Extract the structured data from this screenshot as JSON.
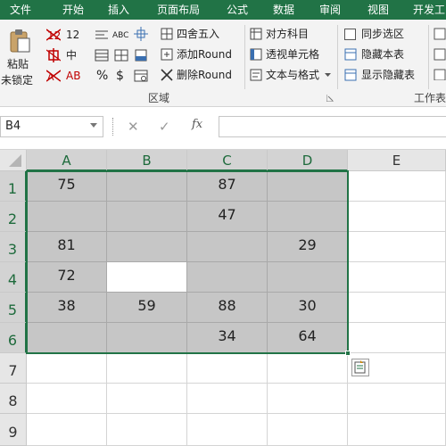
{
  "ribbon_tabs": [
    "文件",
    "开始",
    "插入",
    "页面布局",
    "公式",
    "数据",
    "审阅",
    "视图",
    "开发工"
  ],
  "ribbon": {
    "paste_label": "粘贴",
    "unlock_label": "未锁定",
    "btn_12": "12",
    "btn_zhong": "中",
    "btn_ab": "AB",
    "btn_percent": "%",
    "btn_dollar": "$",
    "btn_abc": "ABC",
    "round_label": "四舍五入",
    "add_round_label": "添加Round",
    "delete_round_label": "删除Round",
    "group_label_region": "区域",
    "subject_label": "对方科目",
    "pivot_label": "透视单元格",
    "text_format_label": "文本与格式",
    "sync_select_label": "同步选区",
    "hide_sheet_label": "隐藏本表",
    "show_hidden_label": "显示隐藏表",
    "group_label_worksheet": "工作表"
  },
  "formula_bar": {
    "name_box": "B4",
    "cancel_symbol": "✕",
    "confirm_symbol": "✓",
    "fx_label": "fx",
    "formula_value": ""
  },
  "grid": {
    "columns": [
      "A",
      "B",
      "C",
      "D",
      "E"
    ],
    "rows": [
      "1",
      "2",
      "3",
      "4",
      "5",
      "6",
      "7",
      "8",
      "9"
    ],
    "cells": [
      [
        "75",
        "",
        "87",
        "",
        ""
      ],
      [
        "",
        "",
        "47",
        "",
        ""
      ],
      [
        "81",
        "",
        "",
        "29",
        ""
      ],
      [
        "72",
        "",
        "",
        "",
        ""
      ],
      [
        "38",
        "59",
        "88",
        "30",
        ""
      ],
      [
        "",
        "",
        "34",
        "64",
        ""
      ],
      [
        "",
        "",
        "",
        "",
        ""
      ],
      [
        "",
        "",
        "",
        "",
        ""
      ],
      [
        "",
        "",
        "",
        "",
        ""
      ]
    ],
    "selection": "A1:D6",
    "active_cell": "B4"
  },
  "colors": {
    "accent": "#217346",
    "selection_fill": "#c6c6c6",
    "header_fill": "#e6e6e6"
  },
  "icons": [
    "paste-icon",
    "strikethrough-12-icon",
    "strikethrough-zhong-icon",
    "strikethrough-ab-icon",
    "percent-icon",
    "currency-icon",
    "abc-format-icon",
    "round-icon",
    "add-round-icon",
    "delete-round-icon",
    "subject-icon",
    "pivot-icon",
    "text-format-icon",
    "checkbox-icon",
    "quick-analysis-icon"
  ]
}
